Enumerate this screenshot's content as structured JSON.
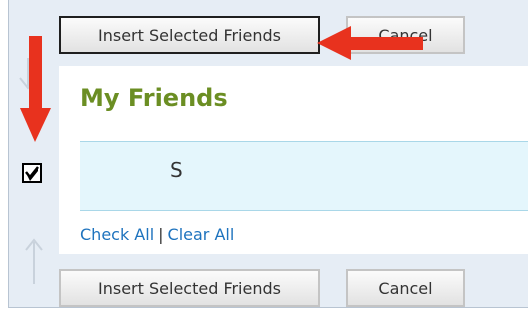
{
  "top_buttons": {
    "insert_label": "Insert Selected Friends",
    "cancel_label": "Cancel"
  },
  "friends": {
    "title": "My Friends",
    "items": [
      "S"
    ],
    "check_all": "Check All",
    "separator": "|",
    "clear_all": "Clear All"
  },
  "bottom_buttons": {
    "insert_label": "Insert Selected Friends",
    "cancel_label": "Cancel"
  },
  "checkbox": {
    "checked": true
  },
  "colors": {
    "annotation_arrow": "#e8321e",
    "title": "#6b8e23",
    "link": "#1e73be",
    "row_bg": "#e4f6fc"
  }
}
